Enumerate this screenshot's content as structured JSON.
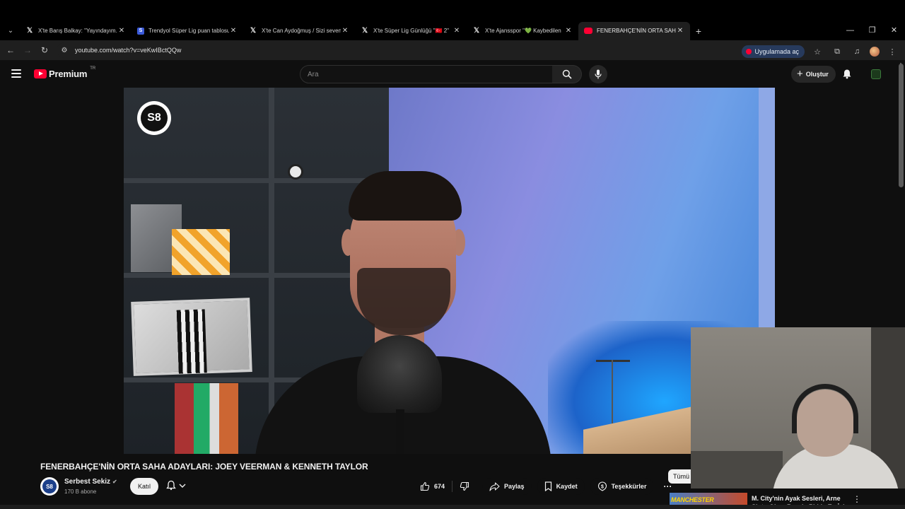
{
  "browser": {
    "tabs": [
      {
        "favicon": "x-icon",
        "title": "X'te Barış Balkay: \"Yayındayım.\"",
        "active": false
      },
      {
        "favicon": "trendyol-icon",
        "title": "Trendyol Süper Lig puan tablosu",
        "active": false
      },
      {
        "favicon": "x-icon",
        "title": "X'te Can Aydoğmuş / Sizi seven",
        "active": false
      },
      {
        "favicon": "x-icon",
        "title": "X'te Süper Lig Günlüğü \"🇹🇷 2\"",
        "active": false
      },
      {
        "favicon": "x-icon",
        "title": "X'te Ajansspor \"💚 Kaybedilen",
        "active": false
      },
      {
        "favicon": "youtube-icon",
        "title": "FENERBAHÇE'NİN ORTA SAHA",
        "active": true
      }
    ],
    "url": "youtube.com/watch?v=veKwIBctQQw",
    "open_in_app_label": "Uygulamada aç"
  },
  "youtube": {
    "logo_text": "Premium",
    "region": "TR",
    "search_placeholder": "Ara",
    "create_label": "Oluştur"
  },
  "video": {
    "watermark": "S8",
    "title": "FENERBAHÇE'NİN ORTA SAHA ADAYLARI: JOEY VEERMAN & KENNETH TAYLOR",
    "channel": {
      "name": "Serbest Sekiz",
      "avatar_text": "S8",
      "subscribers": "170 B abone",
      "join_label": "Katıl"
    },
    "actions": {
      "likes": "674",
      "share_label": "Paylaş",
      "save_label": "Kaydet",
      "thanks_label": "Teşekkürler"
    }
  },
  "sidebar": {
    "chip_label": "Tümü",
    "recommendation": {
      "thumb_text": "MANCHESTER",
      "title": "M. City'nin Ayak Sesleri, Arne Slot - Okan Buruk, PL'de En İyi"
    }
  }
}
